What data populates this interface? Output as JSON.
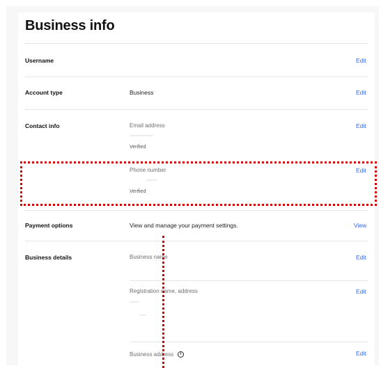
{
  "page": {
    "title": "Business info",
    "edit_label": "Edit",
    "view_label": "View"
  },
  "rows": {
    "username": {
      "label": "Username"
    },
    "account_type": {
      "label": "Account type",
      "value": "Business"
    },
    "contact_info": {
      "label": "Contact info",
      "email_label": "Email address",
      "email_status": "Verified",
      "phone_label": "Phone number",
      "phone_status": "Verified"
    },
    "payment_options": {
      "label": "Payment options",
      "value": "View and manage your payment settings."
    },
    "business_details": {
      "label": "Business details",
      "business_name_label": "Business name",
      "registration_label": "Registration name, address",
      "business_address_label": "Business address"
    }
  },
  "colors": {
    "link": "#3665f3",
    "annotation": "#d10000"
  },
  "icons": [
    "info-icon"
  ]
}
